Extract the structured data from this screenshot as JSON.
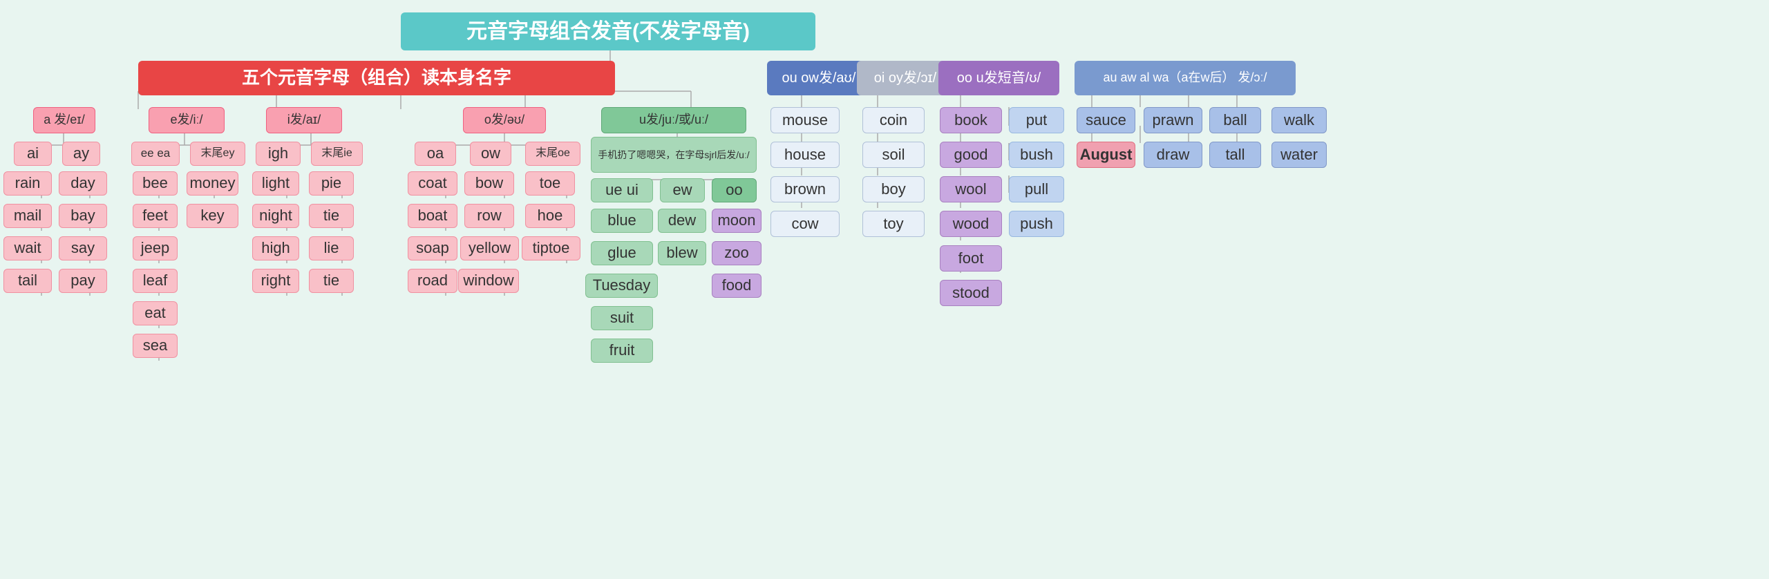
{
  "title": "元音字母组合发音(不发字母音)",
  "sections": {
    "main_title": "元音字母组合发音(不发字母音)",
    "red_title": "五个元音字母（组合）读本身名字",
    "blue1_title": "ou ow发/aʊ/",
    "gray1_title": "oi oy发/ɔɪ/",
    "purple1_title": "oo u发短音/ʊ/",
    "darkblue1_title": "au aw al wa（a在w后） 发/ɔː/"
  },
  "nodes": {
    "a_group": {
      "label": "a 发/eɪ/",
      "children": [
        "ai",
        "ay"
      ],
      "ai_children": [
        "rain",
        "mail",
        "wait",
        "tail"
      ],
      "ay_children": [
        "day",
        "bay",
        "say",
        "pay"
      ]
    },
    "e_group": {
      "label": "e发/iː/",
      "children": [
        "ee ea",
        "末尾ey"
      ],
      "ee_children": [
        "bee",
        "feet",
        "jeep",
        "leaf",
        "eat",
        "sea"
      ],
      "ey_children": [
        "money",
        "key"
      ]
    },
    "i_group": {
      "label": "i发/aɪ/",
      "children": [
        "igh",
        "末尾ie"
      ],
      "igh_children": [
        "light",
        "night",
        "high",
        "right"
      ],
      "ie_children": [
        "pie",
        "tie",
        "lie",
        "tie"
      ]
    },
    "o_group": {
      "label": "o发/əʊ/",
      "children": [
        "oa",
        "ow",
        "末尾oe"
      ],
      "oa_children": [
        "coat",
        "boat",
        "soap",
        "road"
      ],
      "ow_children": [
        "bow",
        "row",
        "yellow",
        "window"
      ],
      "oe_children": [
        "toe",
        "hoe",
        "tiptoe"
      ]
    },
    "u_group": {
      "label": "u发/juː/或/uː/",
      "note": "手机扔了嗯嗯哭，在字母sjrl后发/uː/",
      "ue_ui": [
        "blue",
        "glue",
        "Tuesday",
        "suit",
        "fruit"
      ],
      "ew": [
        "dew",
        "blew"
      ],
      "oo": [
        "moon",
        "zoo",
        "food"
      ]
    },
    "ou_ow": {
      "children": [
        "mouse",
        "house",
        "brown",
        "cow"
      ]
    },
    "oi_oy": {
      "children": [
        "coin",
        "soil",
        "boy",
        "toy"
      ]
    },
    "oo_u": {
      "children": [
        "book",
        "good",
        "wool",
        "wood",
        "foot",
        "stood"
      ],
      "right": [
        "put",
        "bush",
        "pull",
        "push"
      ]
    },
    "au_aw": {
      "left": [
        "sauce",
        "August"
      ],
      "prawn_draw": [
        "prawn",
        "draw"
      ],
      "ball_tall": [
        "ball",
        "tall"
      ],
      "walk_water": [
        "walk",
        "water"
      ]
    }
  }
}
